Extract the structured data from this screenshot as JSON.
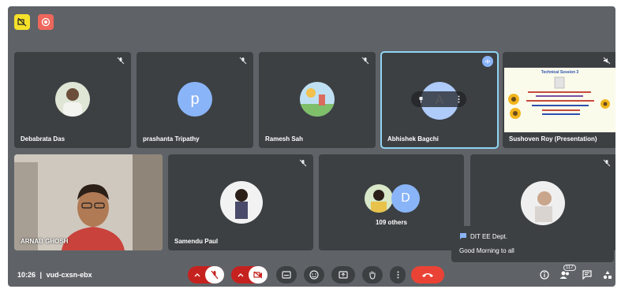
{
  "participants": [
    {
      "name": "Debabrata Das"
    },
    {
      "name": "prashanta Tripathy",
      "initial": "p"
    },
    {
      "name": "Ramesh Sah"
    },
    {
      "name": "Abhishek Bagchi",
      "initial": "A"
    },
    {
      "name": "Sushoven Roy (Presentation)"
    },
    {
      "name": "ARNAB GHOSH"
    },
    {
      "name": "Samendu Paul"
    },
    {
      "name": "109 others",
      "initial": "D"
    },
    {
      "name": ""
    }
  ],
  "presentation": {
    "title": "Technical Session 3"
  },
  "chat_toast": {
    "sender": "DIT EE Dept.",
    "message": "Good Morning to all"
  },
  "meeting": {
    "time": "10:26",
    "separator": "|",
    "code": "vud-cxsn-ebx",
    "participant_count": "117"
  },
  "colors": {
    "stage": "#5f6368",
    "tile": "#3c4043",
    "active_outline": "#8fd3f4",
    "hangup": "#ea4335",
    "muted_red": "#c5221f",
    "avatar_blue": "#8ab4f8"
  }
}
